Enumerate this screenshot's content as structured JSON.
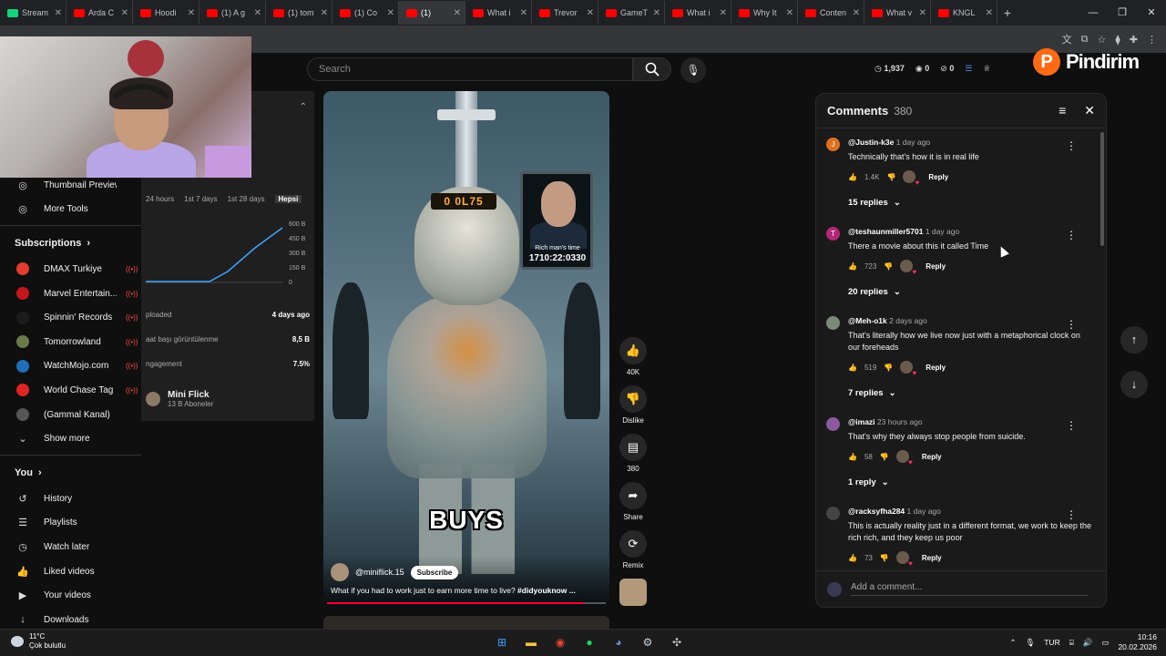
{
  "browser": {
    "tabs": [
      {
        "label": "Stream",
        "icon": "twitch-icon"
      },
      {
        "label": "Arda C",
        "icon": "youtube-icon"
      },
      {
        "label": "Hoodi",
        "icon": "youtube-icon"
      },
      {
        "label": "(1) A g",
        "icon": "youtube-icon"
      },
      {
        "label": "(1) tom",
        "icon": "youtube-icon"
      },
      {
        "label": "(1) Co",
        "icon": "youtube-icon"
      },
      {
        "label": "(1)",
        "icon": "youtube-icon",
        "active": true
      },
      {
        "label": "What i",
        "icon": "youtube-icon"
      },
      {
        "label": "Trevor",
        "icon": "youtube-icon"
      },
      {
        "label": "GameT",
        "icon": "youtube-icon"
      },
      {
        "label": "What i",
        "icon": "youtube-icon"
      },
      {
        "label": "Why It",
        "icon": "youtube-icon"
      },
      {
        "label": "Conten",
        "icon": "youtube-icon"
      },
      {
        "label": "What v",
        "icon": "youtube-icon"
      },
      {
        "label": "KNGL",
        "icon": "youtube-icon"
      }
    ],
    "new_tab": "+"
  },
  "search": {
    "placeholder": "Search"
  },
  "header_stats": {
    "views": "1,937",
    "likes": "0",
    "comments": "0"
  },
  "overlay": {
    "brand": "Pindirim"
  },
  "sidebar": {
    "top_items": [
      {
        "label": "Thumbnail Preview",
        "icon": "image-icon"
      },
      {
        "label": "More Tools",
        "icon": "tools-icon"
      }
    ],
    "subscriptions_title": "Subscriptions",
    "subscriptions": [
      {
        "label": "DMAX Turkiye",
        "color": "#e43b2c"
      },
      {
        "label": "Marvel Entertain...",
        "color": "#c4161c"
      },
      {
        "label": "Spinnin' Records",
        "color": "#1c1c1c"
      },
      {
        "label": "Tomorrowland",
        "color": "#6b7a4a"
      },
      {
        "label": "WatchMojo.com",
        "color": "#1e6fb8"
      },
      {
        "label": "World Chase Tag",
        "color": "#e02424"
      },
      {
        "label": "(Gammal Kanal)",
        "color": "#555555"
      }
    ],
    "show_more": "Show more",
    "you_title": "You",
    "you_items": [
      {
        "label": "History",
        "icon": "history-icon"
      },
      {
        "label": "Playlists",
        "icon": "playlists-icon"
      },
      {
        "label": "Watch later",
        "icon": "clock-icon"
      },
      {
        "label": "Liked videos",
        "icon": "thumbs-up-icon"
      },
      {
        "label": "Your videos",
        "icon": "video-icon"
      },
      {
        "label": "Downloads",
        "icon": "download-icon"
      }
    ]
  },
  "studio_panel": {
    "ranges": [
      "24 hours",
      "1st 7 days",
      "1st 28 days",
      "Hepsi"
    ],
    "y_ticks": [
      "600 B",
      "450 B",
      "300 B",
      "150 B",
      "0"
    ],
    "rows": [
      {
        "label": "ploaded",
        "value": "4 days ago"
      },
      {
        "label": "aat başı görüntülenme",
        "value": "8,5 B"
      },
      {
        "label": "ngagement",
        "value": "7.5%"
      }
    ],
    "channel_name": "Mini Flick",
    "channel_subs": "13 B Aboneler"
  },
  "video": {
    "caption": "BUYS",
    "display_text": "0 0L75",
    "monitor_caption": "Rich man's time",
    "monitor_time": "1710:22:0330",
    "channel": "@miniflick.15",
    "subscribe": "Subscribe",
    "title_plain": "What if you had to work just to earn more time to live? ",
    "title_tag": "#didyouknow ...",
    "progress": 0.92
  },
  "actions": {
    "like": "40K",
    "dislike": "Dislike",
    "comments": "380",
    "share": "Share",
    "remix": "Remix"
  },
  "comments_panel": {
    "title": "Comments",
    "count": "380",
    "items": [
      {
        "handle": "@Justin-k3e",
        "time": "1 day ago",
        "text": "Technically that's how it is in real life",
        "likes": "1.4K",
        "replies": "15 replies",
        "avatar": "J",
        "color": "#e0701f"
      },
      {
        "handle": "@teshaunmiller5701",
        "time": "1 day ago",
        "text": "There a movie about this it called Time",
        "likes": "723",
        "replies": "20 replies",
        "avatar": "T",
        "color": "#b3287a"
      },
      {
        "handle": "@Meh-o1k",
        "time": "2 days ago",
        "text": "That's literally how we live now just with a metaphorical clock on our foreheads",
        "likes": "519",
        "replies": "7 replies",
        "avatar": "",
        "color": "#7b8a7a"
      },
      {
        "handle": "@imazi",
        "time": "23 hours ago",
        "text": "That's why they always stop people from suicide.",
        "likes": "58",
        "replies": "1 reply",
        "avatar": "",
        "color": "#8b5a9c"
      },
      {
        "handle": "@racksyfha284",
        "time": "1 day ago",
        "text": "This is actually reality just in a different format, we work to keep the rich rich, and they keep us poor",
        "likes": "73",
        "replies": "",
        "avatar": "",
        "color": "#444444"
      }
    ],
    "reply_label": "Reply",
    "add_placeholder": "Add a comment..."
  },
  "taskbar": {
    "temp": "11°C",
    "weather": "Çok bulutlu",
    "lang": "TUR",
    "time": "10:16",
    "date": "20.02.2026"
  }
}
